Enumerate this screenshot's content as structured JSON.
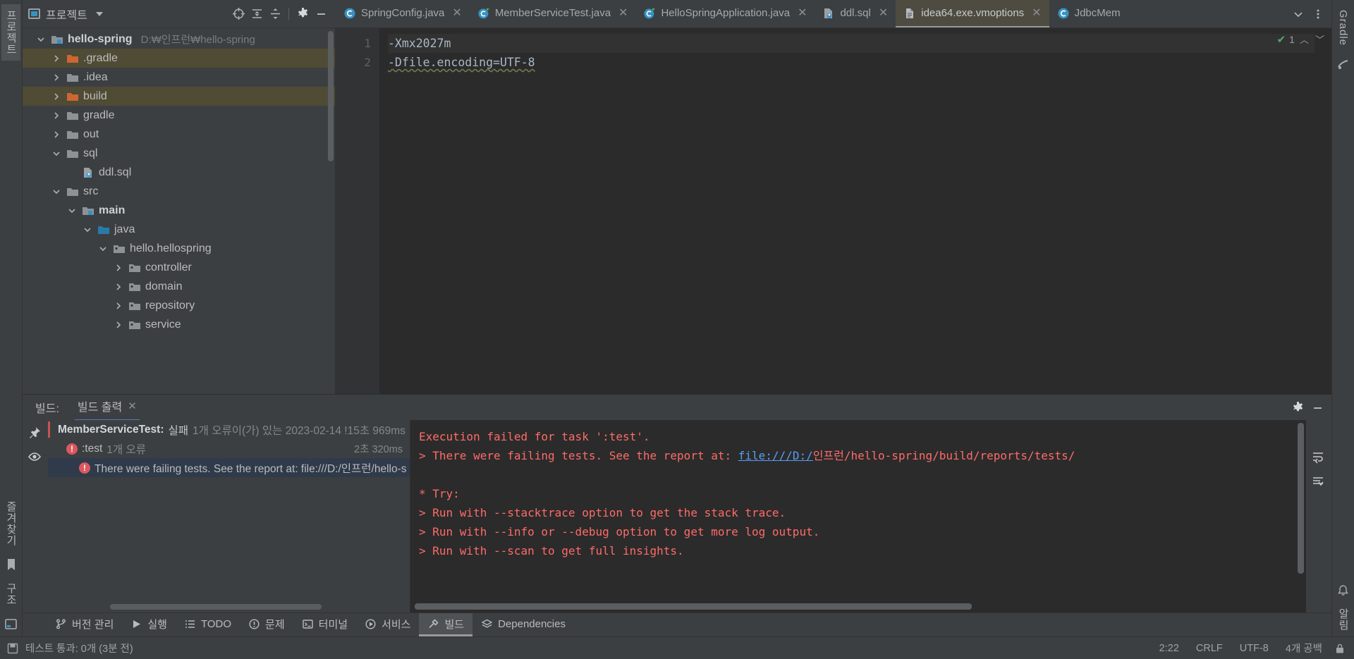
{
  "left_rail": {
    "vertical_tabs": [
      {
        "label": "프로젝트",
        "selected": true
      },
      {
        "label": "즐겨찾기",
        "selected": false
      },
      {
        "label": "구조",
        "selected": false
      }
    ],
    "bottom_icon": "terminal-icon"
  },
  "right_rail": {
    "vertical_tabs": [
      {
        "label": "Gradle",
        "selected": false
      },
      {
        "label": "알림",
        "selected": false
      }
    ]
  },
  "project_panel": {
    "title": "프로젝트",
    "header_icons": [
      "target-icon",
      "collapse-all-icon",
      "expand-all-icon",
      "gear-icon",
      "minimize-icon"
    ],
    "tree": [
      {
        "label": "hello-spring",
        "path": "D:₩인프런₩hello-spring",
        "depth": 0,
        "arrow": "down",
        "icon": "module-folder-icon",
        "bold": true,
        "highlight": false
      },
      {
        "label": ".gradle",
        "path": "",
        "depth": 1,
        "arrow": "right",
        "icon": "folder-orange-icon",
        "bold": false,
        "highlight": true
      },
      {
        "label": ".idea",
        "path": "",
        "depth": 1,
        "arrow": "right",
        "icon": "folder-gray-icon",
        "bold": false,
        "highlight": false
      },
      {
        "label": "build",
        "path": "",
        "depth": 1,
        "arrow": "right",
        "icon": "folder-orange-icon",
        "bold": false,
        "highlight": true
      },
      {
        "label": "gradle",
        "path": "",
        "depth": 1,
        "arrow": "right",
        "icon": "folder-gray-icon",
        "bold": false,
        "highlight": false
      },
      {
        "label": "out",
        "path": "",
        "depth": 1,
        "arrow": "right",
        "icon": "folder-gray-icon",
        "bold": false,
        "highlight": false
      },
      {
        "label": "sql",
        "path": "",
        "depth": 1,
        "arrow": "down",
        "icon": "folder-gray-icon",
        "bold": false,
        "highlight": false
      },
      {
        "label": "ddl.sql",
        "path": "",
        "depth": 2,
        "arrow": "none",
        "icon": "sql-file-icon",
        "bold": false,
        "highlight": false
      },
      {
        "label": "src",
        "path": "",
        "depth": 1,
        "arrow": "down",
        "icon": "folder-gray-icon",
        "bold": false,
        "highlight": false
      },
      {
        "label": "main",
        "path": "",
        "depth": 2,
        "arrow": "down",
        "icon": "module-folder-icon",
        "bold": true,
        "highlight": false
      },
      {
        "label": "java",
        "path": "",
        "depth": 3,
        "arrow": "down",
        "icon": "folder-blue-icon",
        "bold": false,
        "highlight": false
      },
      {
        "label": "hello.hellospring",
        "path": "",
        "depth": 4,
        "arrow": "down",
        "icon": "package-icon",
        "bold": false,
        "highlight": false
      },
      {
        "label": "controller",
        "path": "",
        "depth": 5,
        "arrow": "right",
        "icon": "package-icon",
        "bold": false,
        "highlight": false
      },
      {
        "label": "domain",
        "path": "",
        "depth": 5,
        "arrow": "right",
        "icon": "package-icon",
        "bold": false,
        "highlight": false
      },
      {
        "label": "repository",
        "path": "",
        "depth": 5,
        "arrow": "right",
        "icon": "package-icon",
        "bold": false,
        "highlight": false
      },
      {
        "label": "service",
        "path": "",
        "depth": 5,
        "arrow": "right",
        "icon": "package-icon",
        "bold": false,
        "highlight": false
      }
    ]
  },
  "editor_tabs": [
    {
      "label": "SpringConfig.java",
      "icon": "java-class-icon",
      "active": false,
      "closable": true
    },
    {
      "label": "MemberServiceTest.java",
      "icon": "java-test-class-icon",
      "active": false,
      "closable": true
    },
    {
      "label": "HelloSpringApplication.java",
      "icon": "java-run-class-icon",
      "active": false,
      "closable": true
    },
    {
      "label": "ddl.sql",
      "icon": "sql-file-icon",
      "active": false,
      "closable": true
    },
    {
      "label": "idea64.exe.vmoptions",
      "icon": "text-file-icon",
      "active": true,
      "closable": true
    },
    {
      "label": "JdbcMem",
      "icon": "java-class-icon",
      "active": false,
      "closable": false
    }
  ],
  "tabstrip_right_icons": [
    "chevron-down-icon",
    "more-vertical-icon"
  ],
  "editor": {
    "lines": [
      {
        "num": "1",
        "text": "-Xmx2027m",
        "current": true,
        "squiggle": false
      },
      {
        "num": "2",
        "text": "-Dfile.encoding=UTF-8",
        "current": false,
        "squiggle": true
      }
    ],
    "inspection_count": "1",
    "inspection_status": "ok"
  },
  "build_window": {
    "label": "빌드:",
    "tab_label": "빌드 출력",
    "header_icons": [
      "gear-icon",
      "minimize-icon"
    ],
    "rail_icons": [
      "pin-icon",
      "eye-icon"
    ],
    "right_rail_icons": [
      "soft-wrap-icon",
      "scroll-to-end-icon"
    ],
    "tree": [
      {
        "name": "MemberServiceTest:",
        "status": "실패",
        "detail": "1개 오류이(가) 있는 2023-02-14 !15초 969ms",
        "time": "",
        "level": 0,
        "error_icon": false,
        "selected": false
      },
      {
        "name": "",
        "status": ":test",
        "detail": "1개 오류",
        "time": "2초 320ms",
        "level": 1,
        "error_icon": true,
        "selected": false
      },
      {
        "name": "",
        "status": "There were failing tests. See the report at: file:///D:/인프런/hello-s",
        "detail": "",
        "time": "",
        "level": 2,
        "error_icon": true,
        "selected": true
      }
    ],
    "console_lines": [
      {
        "segments": [
          {
            "text": "Execution failed for task ':test'.",
            "link": false
          }
        ]
      },
      {
        "segments": [
          {
            "text": "> There were failing tests. See the report at: ",
            "link": false
          },
          {
            "text": "file:///D:/",
            "link": true
          },
          {
            "text": "인프런/hello-spring/build/reports/tests/",
            "link": false
          }
        ]
      },
      {
        "segments": [
          {
            "text": "",
            "link": false
          }
        ]
      },
      {
        "segments": [
          {
            "text": "* Try:",
            "link": false
          }
        ]
      },
      {
        "segments": [
          {
            "text": "> Run with --stacktrace option to get the stack trace.",
            "link": false
          }
        ]
      },
      {
        "segments": [
          {
            "text": "> Run with --info or --debug option to get more log output.",
            "link": false
          }
        ]
      },
      {
        "segments": [
          {
            "text": "> Run with --scan to get full insights.",
            "link": false
          }
        ]
      }
    ]
  },
  "bottom_toolbar": [
    {
      "label": "버전 관리",
      "icon": "branch-icon",
      "active": false
    },
    {
      "label": "실행",
      "icon": "run-icon",
      "active": false
    },
    {
      "label": "TODO",
      "icon": "list-icon",
      "active": false
    },
    {
      "label": "문제",
      "icon": "warning-icon",
      "active": false
    },
    {
      "label": "터미널",
      "icon": "terminal-icon",
      "active": false
    },
    {
      "label": "서비스",
      "icon": "services-icon",
      "active": false
    },
    {
      "label": "빌드",
      "icon": "hammer-icon",
      "active": true
    },
    {
      "label": "Dependencies",
      "icon": "layers-icon",
      "active": false
    }
  ],
  "status_bar": {
    "left_icon": "save-icon",
    "message": "테스트 통과: 0개 (3분 전)",
    "items": [
      "2:22",
      "CRLF",
      "UTF-8",
      "4개 공백"
    ],
    "right_icon": "lock-icon"
  },
  "colors": {
    "accent_blue": "#4f7cb5",
    "error_red": "#ff6b68",
    "link_blue": "#589df6",
    "tab_active_bg": "#4e4b41",
    "tree_highlight": "#4f4b35",
    "selection_blue": "#2f3a4a",
    "panel_bg": "#3c3f41",
    "editor_bg": "#2b2b2b"
  }
}
